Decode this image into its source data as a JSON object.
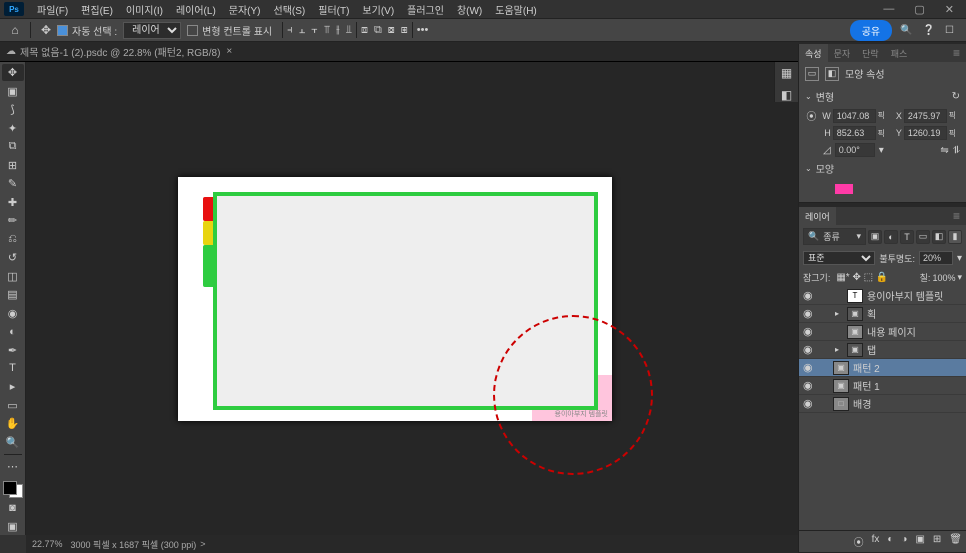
{
  "app": {
    "ps_label": "Ps"
  },
  "menu": {
    "file": "파일(F)",
    "edit": "편집(E)",
    "image": "이미지(I)",
    "layer": "레이어(L)",
    "type": "문자(Y)",
    "select": "선택(S)",
    "filter": "필터(T)",
    "view": "보기(V)",
    "plugin": "플러그인",
    "window": "창(W)",
    "help": "도움말(H)"
  },
  "options": {
    "auto_select": "자동 선택 :",
    "auto_select_value": "레이어",
    "show_transform": "변형 컨트롤 표시",
    "share": "공유"
  },
  "tab": {
    "title": "제목 없음-1 (2).psdc @ 22.8% (패턴2, RGB/8)",
    "close": "×"
  },
  "status": {
    "zoom": "22.77%",
    "info": "3000 픽셀 x 1687 픽셀 (300 ppi)",
    "arrow": ">"
  },
  "canvas": {
    "pink_label": "용이아부지 템플릿"
  },
  "properties": {
    "tab_properties": "속성",
    "tab_character": "문자",
    "tab_paragraph": "단락",
    "tab_adjustments": "패스",
    "title": "모양 속성",
    "section_transform": "변형",
    "W_label": "W",
    "W_value": "1047.08",
    "X_label": "X",
    "X_value": "2475.97",
    "H_label": "H",
    "H_value": "852.63",
    "Y_label": "Y",
    "Y_value": "1260.19",
    "unit": "픽",
    "angle_value": "0.00°",
    "section_appearance": "모양"
  },
  "layers": {
    "tab": "레이어",
    "filter_label": "종류",
    "blend_mode": "표준",
    "opacity_label": "불투명도:",
    "opacity_value": "20%",
    "lock_label": "잠그기:",
    "fill_label": "칠:",
    "fill_value": "100%",
    "items": [
      {
        "eye": "◉",
        "caret": "",
        "thumb": "T",
        "name": "용이아부지 템플릿",
        "indent": 1,
        "selected": false
      },
      {
        "eye": "◉",
        "caret": "▸",
        "thumb": "▣",
        "name": "획",
        "indent": 1,
        "selected": false,
        "folder": true
      },
      {
        "eye": "◉",
        "caret": "",
        "thumb": "▣",
        "name": "내용 페이지",
        "indent": 1,
        "selected": false
      },
      {
        "eye": "◉",
        "caret": "▸",
        "thumb": "▣",
        "name": "탭",
        "indent": 1,
        "selected": false,
        "folder": true
      },
      {
        "eye": "◉",
        "caret": "",
        "thumb": "▣",
        "name": "패턴 2",
        "indent": 0,
        "selected": true
      },
      {
        "eye": "◉",
        "caret": "",
        "thumb": "▣",
        "name": "패턴 1",
        "indent": 0,
        "selected": false
      },
      {
        "eye": "◉",
        "caret": "",
        "thumb": "□",
        "name": "배경",
        "indent": 0,
        "selected": false
      }
    ]
  }
}
